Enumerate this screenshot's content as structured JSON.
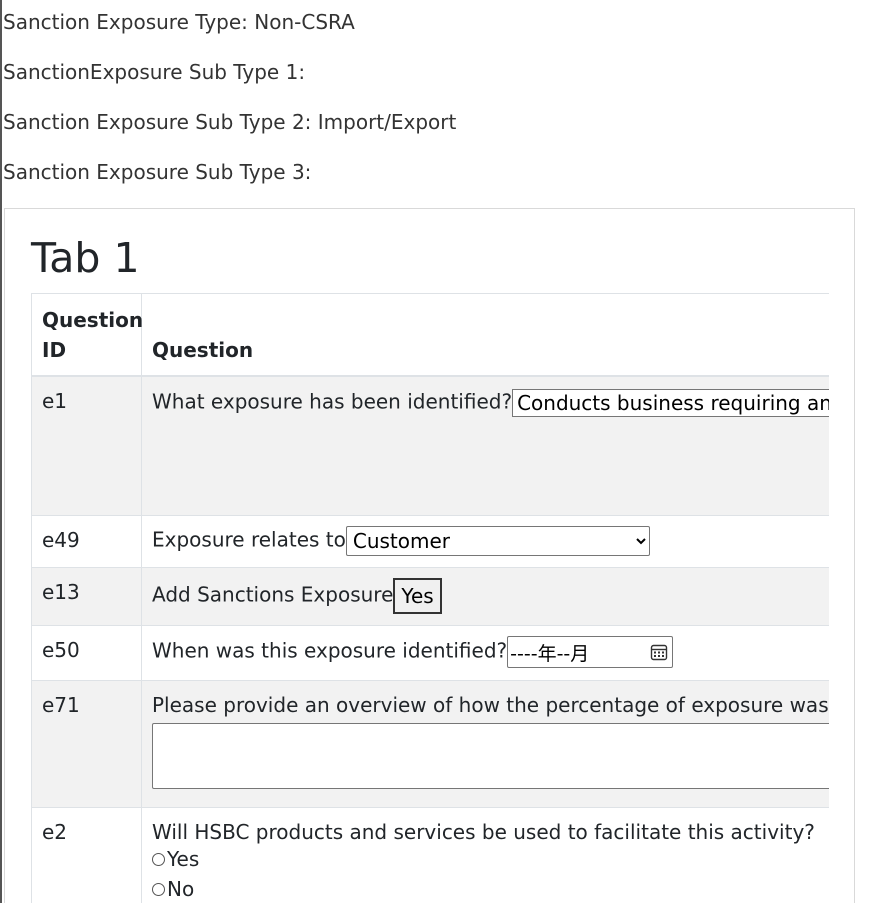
{
  "header": {
    "exposure_type": "Sanction Exposure Type: Non-CSRA",
    "sub_type_1": "SanctionExposure Sub Type 1:",
    "sub_type_2": "Sanction Exposure Sub Type 2: Import/Export",
    "sub_type_3": "Sanction Exposure Sub Type 3:"
  },
  "tab": {
    "title": "Tab 1"
  },
  "table": {
    "headers": {
      "id_line1": "Question",
      "id_line2": "ID",
      "question": "Question"
    },
    "rows": {
      "e1": {
        "id": "e1",
        "question": "What exposure has been identified?",
        "input_value": "Conducts business requiring an Import/Export license"
      },
      "e49": {
        "id": "e49",
        "question": "Exposure relates to",
        "selected": "Customer"
      },
      "e13": {
        "id": "e13",
        "question": "Add Sanctions Exposure",
        "button_label": "Yes"
      },
      "e50": {
        "id": "e50",
        "question": "When was this exposure identified?",
        "date_placeholder": "----年--月"
      },
      "e71": {
        "id": "e71",
        "question": "Please provide an overview of how the percentage of exposure was calculated"
      },
      "e2": {
        "id": "e2",
        "question": "Will HSBC products and services be used to facilitate this activity?",
        "option_yes": "Yes",
        "option_no": "No"
      }
    }
  },
  "icons": {
    "date_picker": "calendar-icon",
    "select_arrow": "chevron-down-icon"
  },
  "colors": {
    "stripe": "#f2f2f2",
    "border": "#dee2e6"
  }
}
